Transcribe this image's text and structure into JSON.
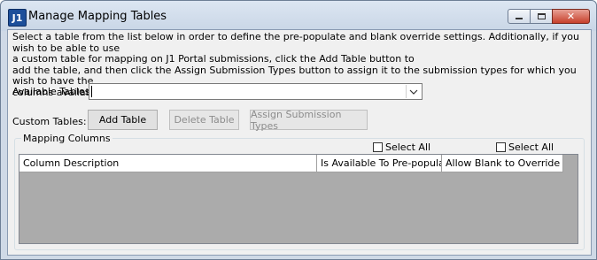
{
  "window": {
    "title": "Manage Mapping Tables",
    "app_icon_text": "J1",
    "caption_buttons": {
      "minimize_icon": "minimize-icon",
      "maximize_icon": "maximize-icon",
      "close_icon": "close-icon",
      "close_glyph": "✕"
    }
  },
  "intro": {
    "text": "Select a table from the list below in order to define the pre-populate and blank override settings. Additionally, if you wish to be able to use a custom table for mapping on J1 Portal submissions, click the Add Table button to add the table, and then click the Assign Submission Types button to assign it to the submission types for which you wish to have the columns available for mapping.",
    "line1": "Select a table from the list below in order to define the pre-populate and blank override settings. Additionally, if you wish to be able to use",
    "line2": "a custom table for mapping on J1 Portal submissions, click the Add Table button to",
    "line3": "add the table, and then click the Assign Submission Types button to assign it to the submission types for which you wish to have the",
    "line4": "columns available for mapping."
  },
  "available_tables": {
    "label": "Available Tables:",
    "value": "",
    "dropdown_icon": "chevron-down-icon"
  },
  "custom_tables": {
    "label": "Custom Tables:",
    "add_label": "Add Table",
    "delete_label": "Delete Table",
    "assign_label": "Assign Submission Types"
  },
  "mapping_columns": {
    "legend": "Mapping Columns",
    "select_all_1": "Select All",
    "select_all_2": "Select All",
    "columns": [
      "Column Description",
      "Is Available To Pre-populate",
      "Allow Blank to Override DB"
    ]
  }
}
